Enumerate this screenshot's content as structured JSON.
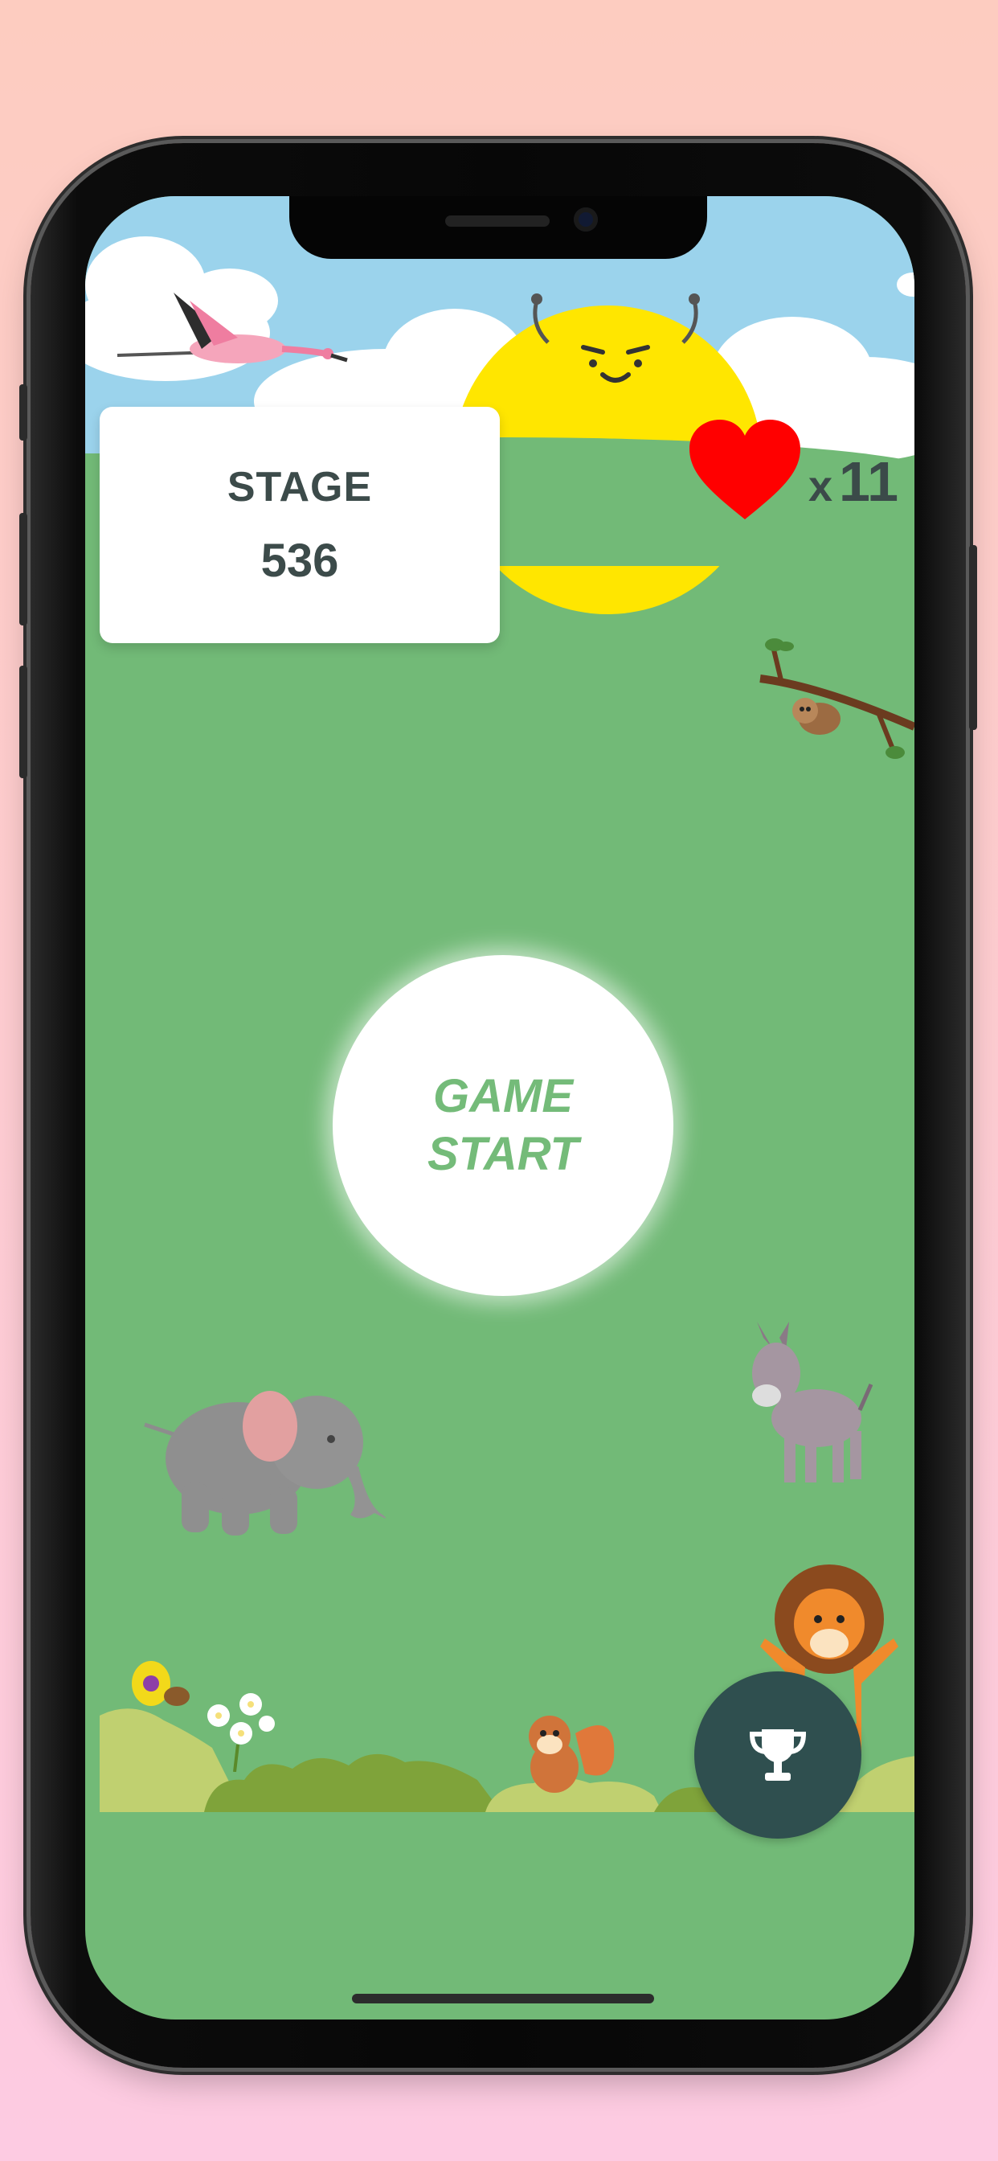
{
  "stage": {
    "label": "STAGE",
    "number": "536"
  },
  "lives": {
    "prefix": "x",
    "count": "11",
    "icon": "heart-icon"
  },
  "start_button": {
    "line1": "GAME",
    "line2": "START"
  },
  "leaderboard_button": {
    "icon": "trophy-icon"
  },
  "colors": {
    "background_top": "#fdccc0",
    "background_bottom": "#fdcbe2",
    "field_green": "#72ba77",
    "sky_blue": "#9bd3ec",
    "sun_yellow": "#ffe600",
    "heart_red": "#ff0000",
    "text_dark": "#3c4b4a",
    "start_text": "#74bb79",
    "fab_bg": "#2f4f4f"
  }
}
